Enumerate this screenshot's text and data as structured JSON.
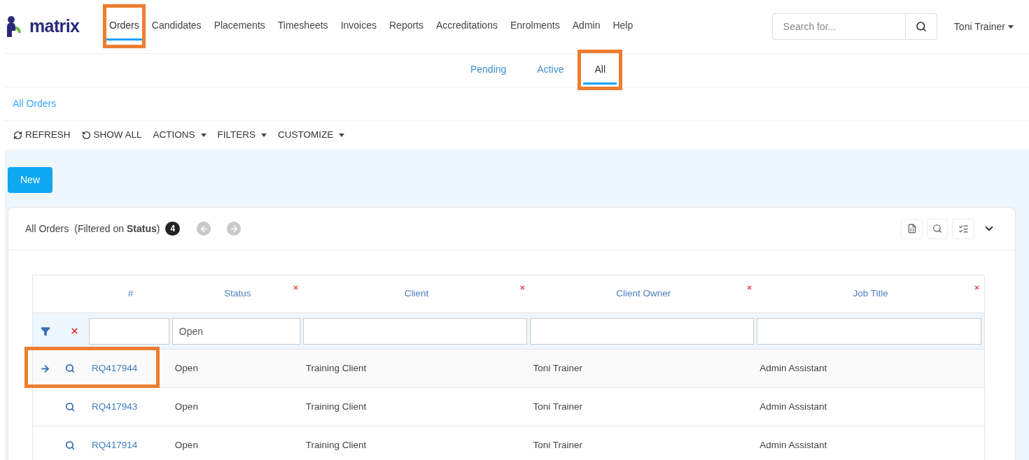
{
  "brand": "matrix",
  "nav": [
    {
      "label": "Orders",
      "selected": true,
      "highlighted": true
    },
    {
      "label": "Candidates",
      "selected": false,
      "highlighted": false
    },
    {
      "label": "Placements",
      "selected": false,
      "highlighted": false
    },
    {
      "label": "Timesheets",
      "selected": false,
      "highlighted": false
    },
    {
      "label": "Invoices",
      "selected": false,
      "highlighted": false
    },
    {
      "label": "Reports",
      "selected": false,
      "highlighted": false
    },
    {
      "label": "Accreditations",
      "selected": false,
      "highlighted": false
    },
    {
      "label": "Enrolments",
      "selected": false,
      "highlighted": false
    },
    {
      "label": "Admin",
      "selected": false,
      "highlighted": false
    },
    {
      "label": "Help",
      "selected": false,
      "highlighted": false
    }
  ],
  "search": {
    "placeholder": "Search for..."
  },
  "user": "Toni Trainer",
  "subtabs": [
    {
      "label": "Pending",
      "selected": false,
      "highlighted": false
    },
    {
      "label": "Active",
      "selected": false,
      "highlighted": false
    },
    {
      "label": "All",
      "selected": true,
      "highlighted": true
    }
  ],
  "breadcrumb": "All Orders",
  "toolbar": [
    {
      "label": "REFRESH",
      "kind": "refresh"
    },
    {
      "label": "SHOW ALL",
      "kind": "undo"
    },
    {
      "label": "ACTIONS",
      "kind": "menu"
    },
    {
      "label": "FILTERS",
      "kind": "menu"
    },
    {
      "label": "CUSTOMIZE",
      "kind": "menu"
    }
  ],
  "new_button": "New",
  "card": {
    "title": "All Orders",
    "filter_note": "(Filtered on **Status**)",
    "count": "4"
  },
  "table": {
    "columns": [
      {
        "label": "#",
        "removable": false
      },
      {
        "label": "Status",
        "removable": true,
        "filter": "Open"
      },
      {
        "label": "Client",
        "removable": true
      },
      {
        "label": "Client Owner",
        "removable": true
      },
      {
        "label": "Job Title",
        "removable": true
      }
    ],
    "rows": [
      {
        "current": true,
        "highlighted": true,
        "cells": [
          "RQ417944",
          "Open",
          "Training Client",
          "Toni Trainer",
          "Admin Assistant"
        ]
      },
      {
        "current": false,
        "highlighted": false,
        "cells": [
          "RQ417943",
          "Open",
          "Training Client",
          "Toni Trainer",
          "Admin Assistant"
        ]
      },
      {
        "current": false,
        "highlighted": false,
        "cells": [
          "RQ417914",
          "Open",
          "Training Client",
          "Toni Trainer",
          "Admin Assistant"
        ]
      }
    ]
  }
}
